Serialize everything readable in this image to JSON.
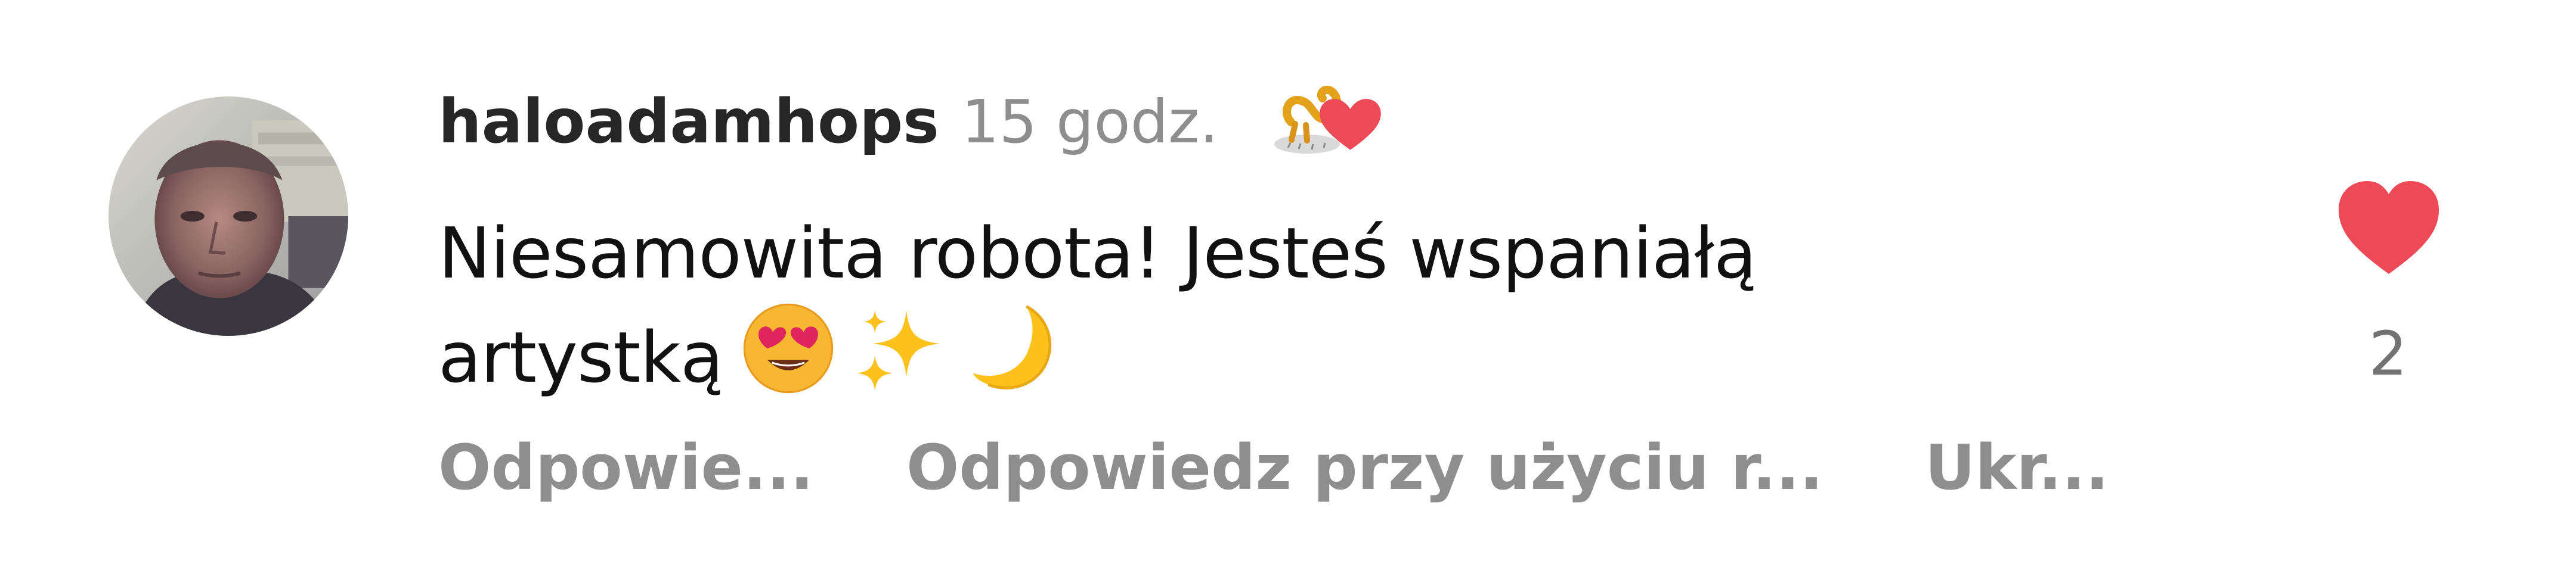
{
  "comment": {
    "username": "haloadamhops",
    "time": "15 godz.",
    "text": "Niesamowita robota! Jesteś wspaniałą artystką",
    "emojis": [
      "heart-eyes-emoji",
      "sparkles-emoji",
      "crescent-moon-emoji"
    ],
    "creator_liked": true,
    "like_count": "2",
    "liked": true
  },
  "actions": {
    "reply": "Odpowie...",
    "reply_with_gif": "Odpowiedz przy użyciu r...",
    "hide": "Ukr..."
  },
  "colors": {
    "heart": "#ed4956",
    "username": "#262626",
    "secondary": "#8e8e8e",
    "text": "#111111"
  }
}
